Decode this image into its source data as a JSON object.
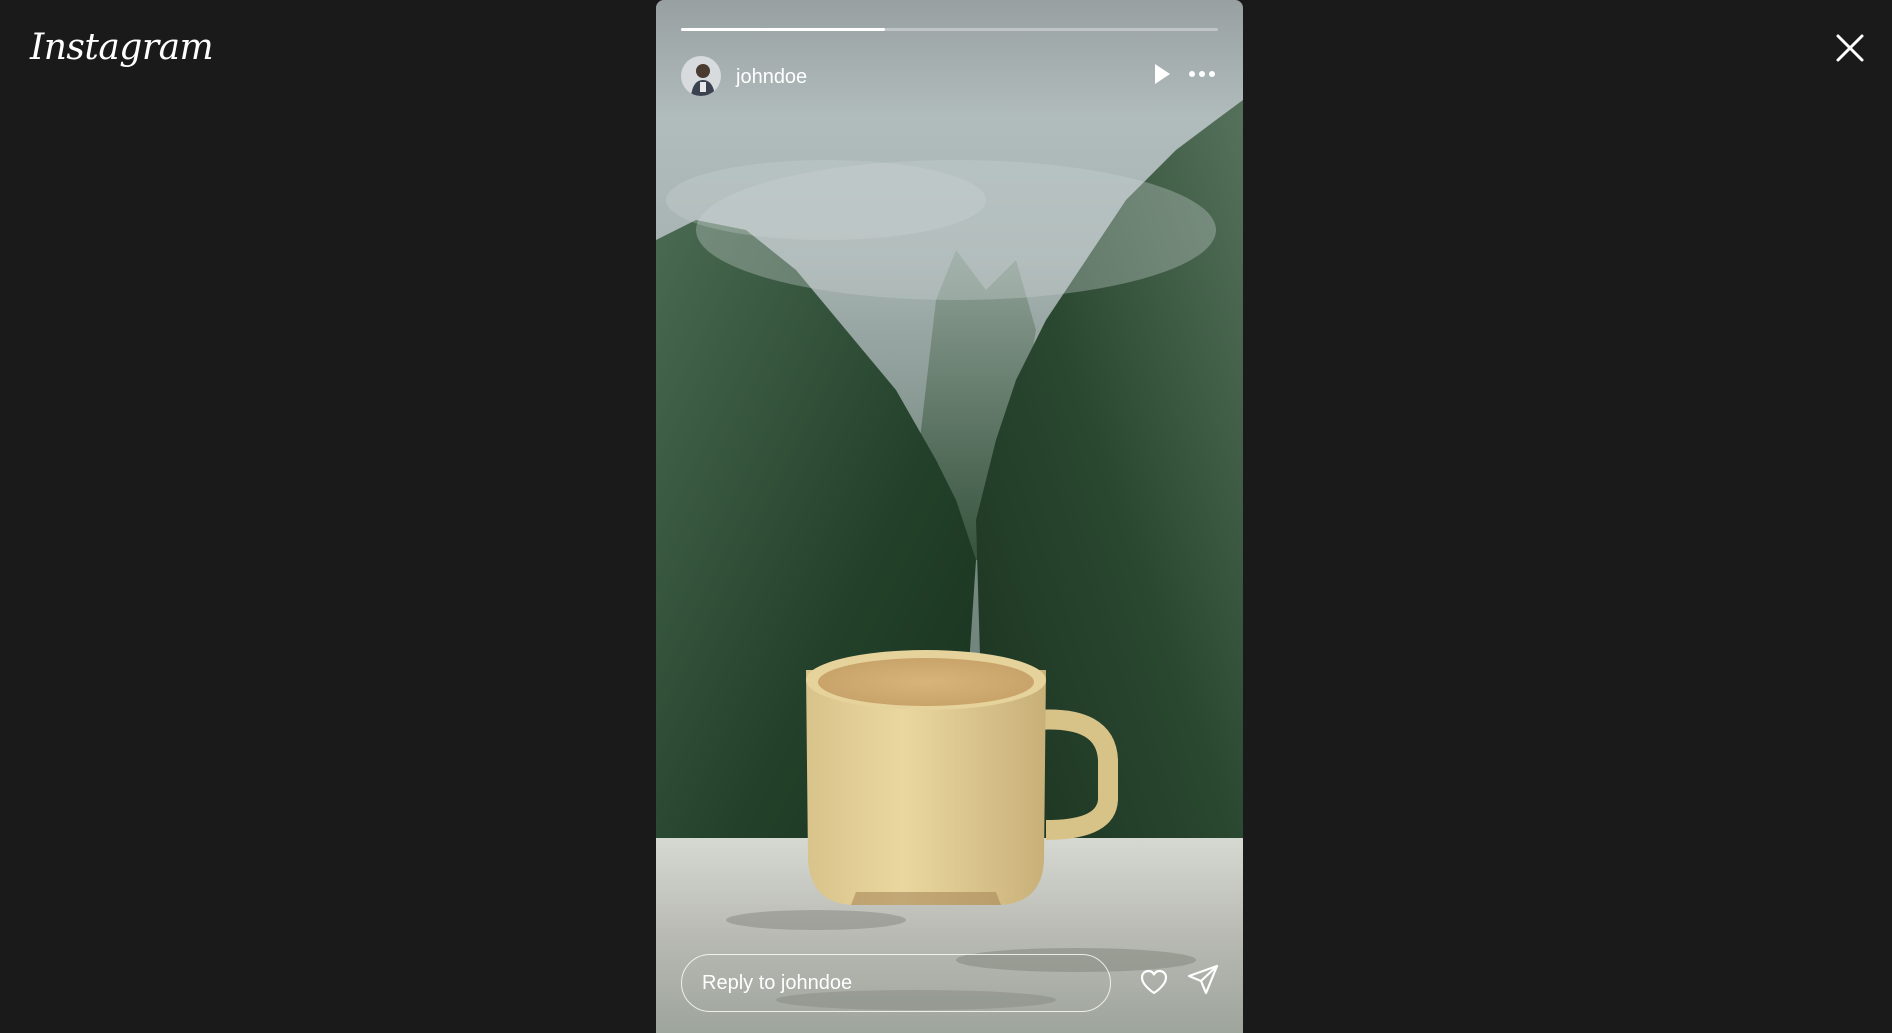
{
  "app": {
    "logo_text": "Instagram"
  },
  "story": {
    "username": "johndoe",
    "timestamp": "",
    "progress": 0.38,
    "reply_placeholder": "Reply to johndoe"
  },
  "icons": {
    "close": "close-icon",
    "play": "play-icon",
    "more": "more-options-icon",
    "like": "heart-icon",
    "share": "send-icon"
  },
  "colors": {
    "background": "#1a1a1a",
    "text": "#ffffff",
    "progress_track": "rgba(255,255,255,0.35)"
  }
}
